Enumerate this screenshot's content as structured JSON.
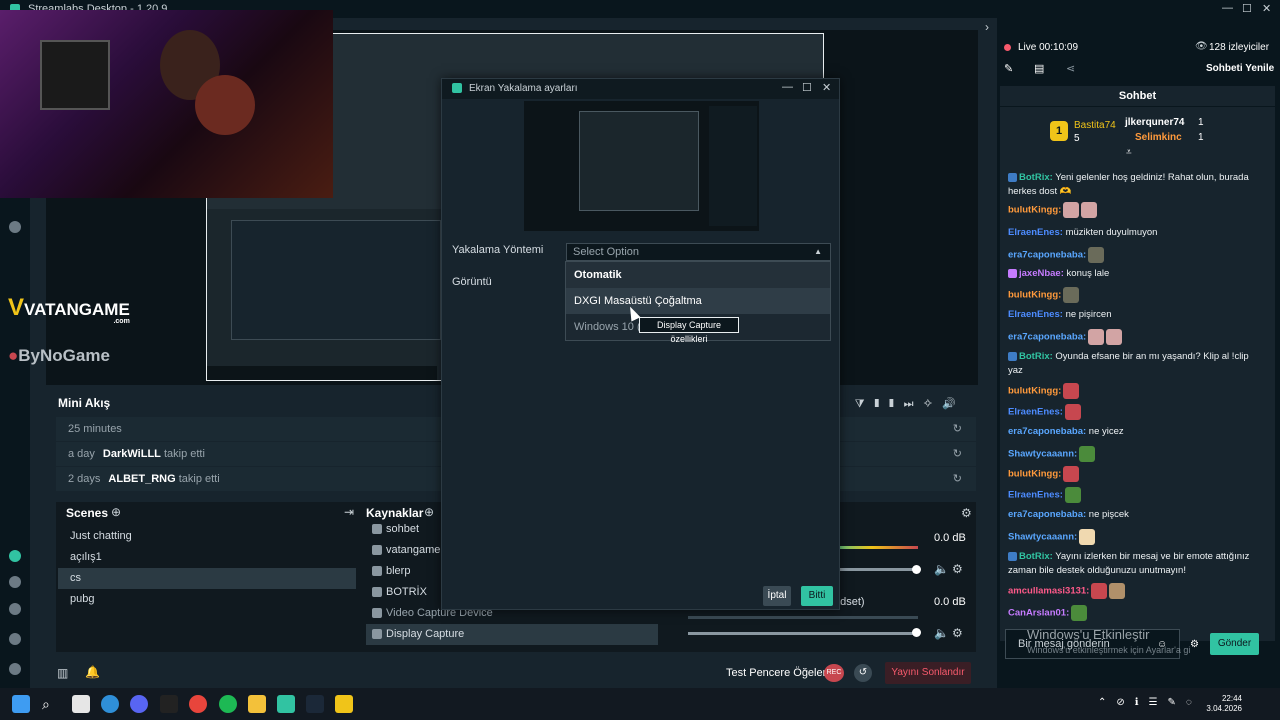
{
  "window": {
    "title": "Streamlabs Desktop - 1.20.9"
  },
  "brands": {
    "vatangame": "VATANGAME",
    "vatangame_sub": ".com",
    "byno": "ByNoGame"
  },
  "mini_feed": {
    "title": "Mini Akış",
    "rows": [
      {
        "time": "25 minutes",
        "user": "",
        "action": ""
      },
      {
        "time": "a day",
        "user": "DarkWiLLL",
        "action": "takip etti"
      },
      {
        "time": "2 days",
        "user": "ALBET_RNG",
        "action": "takip etti"
      }
    ]
  },
  "scenes": {
    "title": "Scenes",
    "items": [
      "Just chatting",
      "açılış1",
      "cs",
      "pubg"
    ],
    "selected": "cs"
  },
  "sources": {
    "title": "Kaynaklar",
    "items": [
      "sohbet",
      "vatangame",
      "blerp",
      "BOTRİX",
      "Video Capture Device",
      "Display Capture"
    ],
    "selected": "Display Capture"
  },
  "mixer": {
    "db1": "0.0 dB",
    "db2": "0.0 dB",
    "label2": "adset)"
  },
  "footer": {
    "test_windows": "Test Pencere Öğeleri",
    "rec": "REC",
    "end_stream": "Yayını Sonlandır"
  },
  "dialog": {
    "title": "Ekran Yakalama ayarları",
    "method_label": "Yakalama Yöntemi",
    "display_label": "Görüntü",
    "select_placeholder": "Select Option",
    "options": [
      "Otomatik",
      "DXGI Masaüstü Çoğaltma",
      "Windows 10 (1"
    ],
    "tooltip": "Display Capture özellikleri",
    "cancel": "İptal",
    "done": "Bitti"
  },
  "stream": {
    "live": "Live 00:10:09",
    "viewers": "128 izleyiciler",
    "refresh_chat": "Sohbeti Yenile"
  },
  "chat": {
    "title": "Sohbet",
    "leaderboard": {
      "rank": "1",
      "first": {
        "name": "Bastita74",
        "score": "5"
      },
      "others": [
        {
          "name": "jlkerquner74",
          "score": "1"
        },
        {
          "name": "Selimkinc",
          "score": "1"
        }
      ]
    },
    "messages": [
      {
        "user": "BotRix:",
        "color": "#31c3a2",
        "text": "Yeni gelenler hoş geldiniz! Rahat olun, burada herkes dost"
      },
      {
        "user": "bulutKingg:",
        "color": "#ff9a3c",
        "text": ""
      },
      {
        "user": "ElraenEnes:",
        "color": "#4d8cff",
        "text": "müzikten duyulmuyon"
      },
      {
        "user": "era7caponebaba:",
        "color": "#5aa7ff",
        "text": ""
      },
      {
        "user": "jaxeNbae:",
        "color": "#c67bff",
        "text": "konuş lale"
      },
      {
        "user": "bulutKingg:",
        "color": "#ff9a3c",
        "text": ""
      },
      {
        "user": "ElraenEnes:",
        "color": "#4d8cff",
        "text": "ne pişircen"
      },
      {
        "user": "era7caponebaba:",
        "color": "#5aa7ff",
        "text": ""
      },
      {
        "user": "BotRix:",
        "color": "#31c3a2",
        "text": "Oyunda efsane bir an mı yaşandı? Klip al !clip yaz"
      },
      {
        "user": "bulutKingg:",
        "color": "#ff9a3c",
        "text": ""
      },
      {
        "user": "ElraenEnes:",
        "color": "#4d8cff",
        "text": ""
      },
      {
        "user": "era7caponebaba:",
        "color": "#5aa7ff",
        "text": "ne yicez"
      },
      {
        "user": "Shawtycaaann:",
        "color": "#5aa7ff",
        "text": ""
      },
      {
        "user": "bulutKingg:",
        "color": "#ff9a3c",
        "text": ""
      },
      {
        "user": "ElraenEnes:",
        "color": "#4d8cff",
        "text": ""
      },
      {
        "user": "era7caponebaba:",
        "color": "#5aa7ff",
        "text": "ne pişcek"
      },
      {
        "user": "Shawtycaaann:",
        "color": "#5aa7ff",
        "text": ""
      },
      {
        "user": "BotRix:",
        "color": "#31c3a2",
        "text": "Yayını izlerken bir mesaj ve bir emote attığınız zaman bile destek olduğunuzu unutmayın!"
      },
      {
        "user": "amcullamasi3131:",
        "color": "#ff5a8a",
        "text": ""
      },
      {
        "user": "CanArslan01:",
        "color": "#c67bff",
        "text": ""
      }
    ],
    "input_placeholder": "Bir mesaj gönderin",
    "send": "Gönder",
    "watermark_title": "Windows'u Etkinleştir",
    "watermark_sub": "Windows'u etkinleştirmek için Ayarlar'a gi"
  },
  "taskbar": {
    "time": "22:44",
    "date": "3.04.2026"
  },
  "colors": {
    "accent": "#31c3a2",
    "danger": "#f75a6c",
    "bg": "#17242d"
  }
}
